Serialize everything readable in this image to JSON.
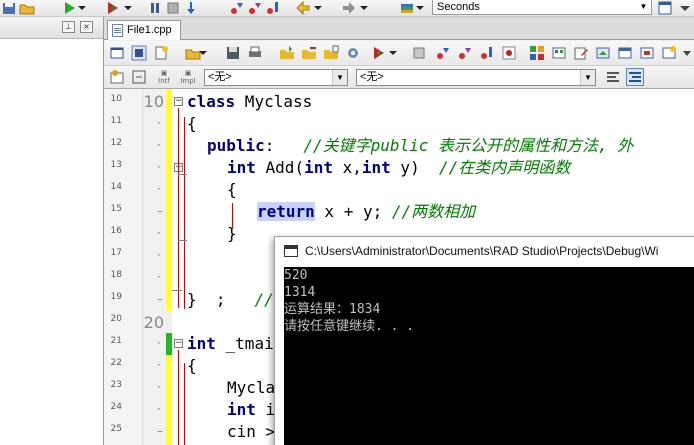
{
  "top_toolbar": {
    "seconds_value": "Seconds"
  },
  "editor": {
    "tab_label": "File1.cpp",
    "scope_combo_1": "<无>",
    "scope_combo_2": "<无>",
    "intf_label": "Intf",
    "impl_label": "Impl",
    "line_numbers": [
      "10",
      "11",
      "12",
      "13",
      "14",
      "15",
      "16",
      "17",
      "18",
      "19",
      "20",
      "21",
      "22",
      "23",
      "24",
      "25"
    ],
    "lines": {
      "l10_kw": "class",
      "l10_rest": " Myclass",
      "l11": "{",
      "l12_kw": "public",
      "l12_rest": ":   ",
      "l12_cm": "//关键字public 表示公开的属性和方法, 外",
      "l13_a": "int",
      "l13_b": " Add(",
      "l13_c": "int",
      "l13_d": " x,",
      "l13_e": "int",
      "l13_f": " y)  ",
      "l13_cm": "//在类内声明函数",
      "l14": "{",
      "l15_kw": "return",
      "l15_rest": " x + y; ",
      "l15_cm": "//两数相加",
      "l16": "}",
      "l19_rest": "}  ;   ",
      "l19_cm": "//",
      "l21_kw": "int",
      "l21_rest": " _tmai",
      "l22": "{",
      "l23": "Mycla",
      "l24_kw": "int",
      "l24_rest": " i",
      "l25": "cin >"
    }
  },
  "console": {
    "title": "C:\\Users\\Administrator\\Documents\\RAD Studio\\Projects\\Debug\\Wi",
    "output": [
      "520",
      "1314",
      "运算结果：1834",
      "请按任意键继续. . ."
    ]
  }
}
